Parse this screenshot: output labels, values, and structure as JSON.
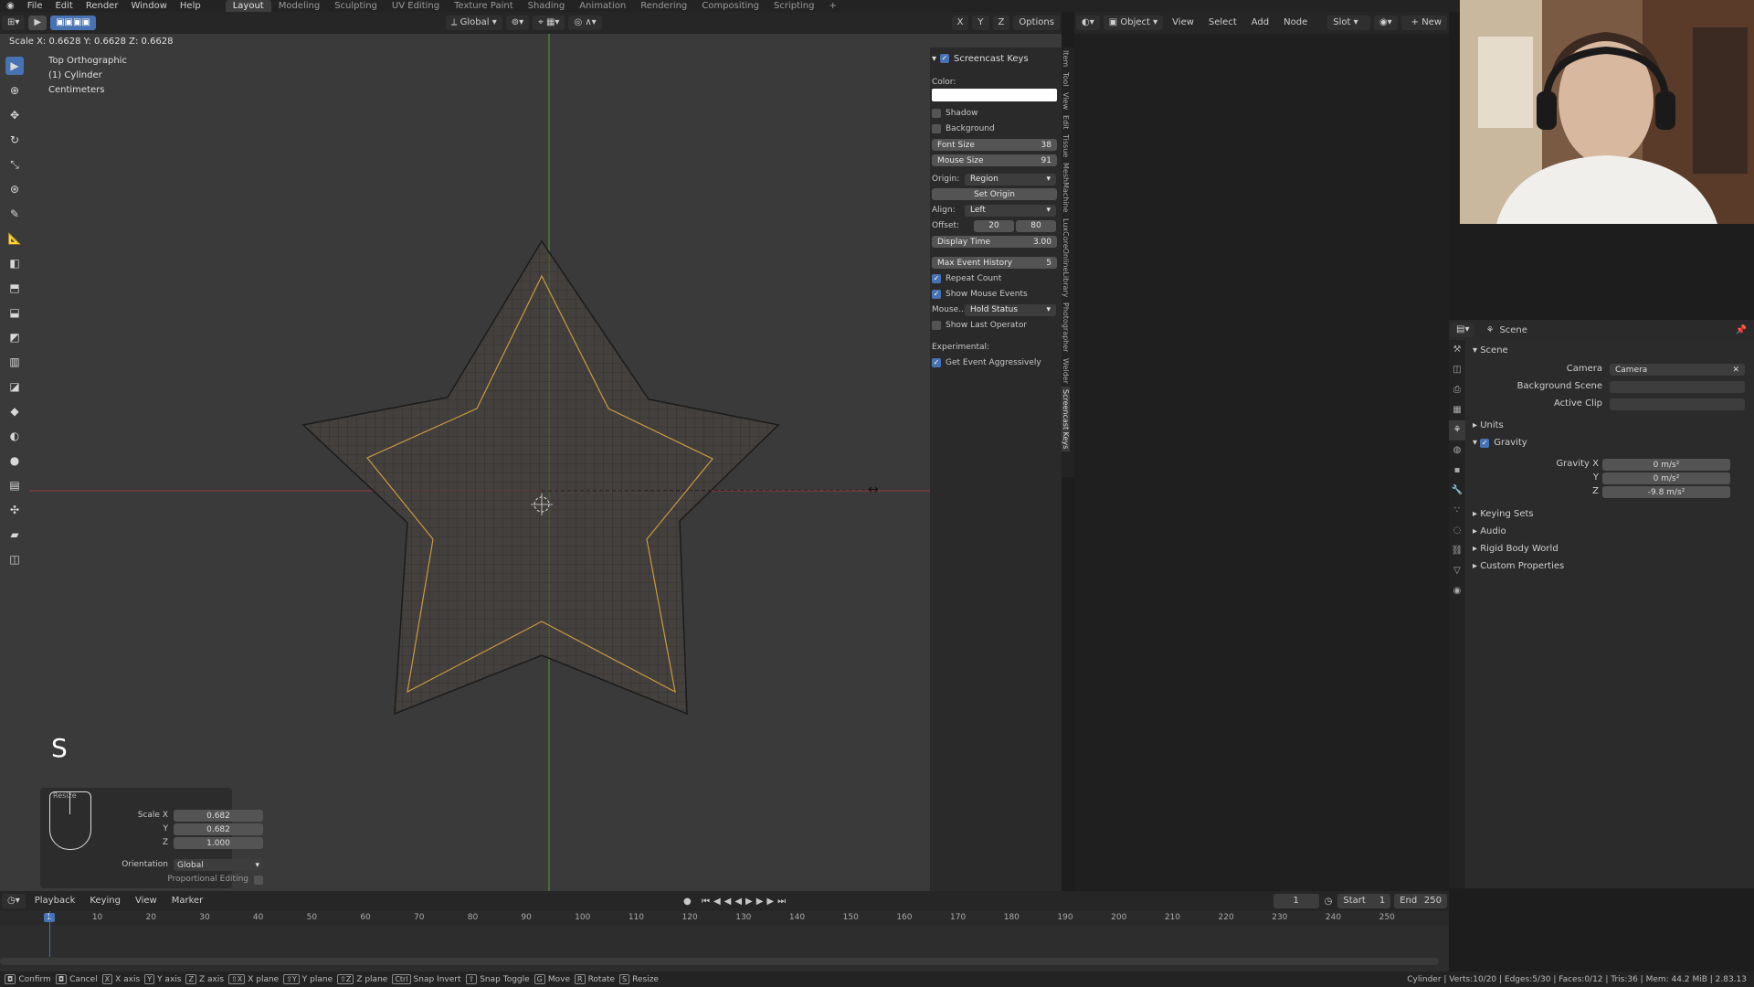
{
  "menu": [
    "File",
    "Edit",
    "Render",
    "Window",
    "Help"
  ],
  "workspaces": [
    "Layout",
    "Modeling",
    "Sculpting",
    "UV Editing",
    "Texture Paint",
    "Shading",
    "Animation",
    "Rendering",
    "Compositing",
    "Scripting",
    "+"
  ],
  "viewport_header": {
    "transform": "Global",
    "options": "Options",
    "axes": [
      "X",
      "Y",
      "Z"
    ]
  },
  "status_scale": "Scale X: 0.6628   Y: 0.6628   Z: 0.6628",
  "overlay": {
    "view": "Top Orthographic",
    "object": "(1) Cylinder",
    "units": "Centimeters"
  },
  "key_overlay": "S",
  "screencast": {
    "title": "Screencast Keys",
    "color_label": "Color:",
    "shadow": "Shadow",
    "background": "Background",
    "font_size_label": "Font Size",
    "font_size": "38",
    "mouse_size_label": "Mouse Size",
    "mouse_size": "91",
    "origin_label": "Origin:",
    "origin": "Region",
    "set_origin": "Set Origin",
    "align_label": "Align:",
    "align": "Left",
    "offset_label": "Offset:",
    "offset_x": "20",
    "offset_y": "80",
    "display_time_label": "Display Time",
    "display_time": "3.00",
    "max_event_label": "Max Event History",
    "max_event": "5",
    "repeat_count": "Repeat Count",
    "show_mouse_events": "Show Mouse Events",
    "mouse_label": "Mouse...",
    "mouse": "Hold Status",
    "show_last_operator": "Show Last Operator",
    "experimental": "Experimental:",
    "get_event": "Get Event Aggressively"
  },
  "npanel_tabs": [
    "Item",
    "Tool",
    "View",
    "Edit",
    "Tissue",
    "MeshMachine",
    "LuxCoreOnlineLibrary",
    "Photographer",
    "Welder",
    "Screencast Keys"
  ],
  "node_header": {
    "object": "Object",
    "view": "View",
    "select": "Select",
    "add": "Add",
    "node": "Node",
    "slot": "Slot",
    "new": "New"
  },
  "props": {
    "context": "Scene",
    "panel": "Scene",
    "camera_label": "Camera",
    "camera": "Camera",
    "bg_scene_label": "Background Scene",
    "active_clip_label": "Active Clip",
    "units": "Units",
    "gravity": "Gravity",
    "gravity_x_label": "Gravity X",
    "gravity_x": "0 m/s²",
    "gravity_y_label": "Y",
    "gravity_y": "0 m/s²",
    "gravity_z_label": "Z",
    "gravity_z": "-9.8 m/s²",
    "keying_sets": "Keying Sets",
    "audio": "Audio",
    "rigid_body": "Rigid Body World",
    "custom_props": "Custom Properties"
  },
  "redo": {
    "title": "Resize",
    "scale_x_label": "Scale X",
    "scale_x": "0.682",
    "y_label": "Y",
    "y": "0.682",
    "z_label": "Z",
    "z": "1.000",
    "orientation_label": "Orientation",
    "orientation": "Global",
    "prop_edit_label": "Proportional Editing"
  },
  "timeline": {
    "menus": [
      "Playback",
      "Keying",
      "View",
      "Marker"
    ],
    "current": "1",
    "start_label": "Start",
    "start": "1",
    "end_label": "End",
    "end": "250",
    "ticks": [
      "1",
      "10",
      "20",
      "30",
      "40",
      "50",
      "60",
      "70",
      "80",
      "90",
      "100",
      "110",
      "120",
      "130",
      "140",
      "150",
      "160",
      "170",
      "180",
      "190",
      "200",
      "210",
      "220",
      "230",
      "240",
      "250"
    ]
  },
  "statusbar": {
    "items": [
      {
        "key": "",
        "label": "Confirm"
      },
      {
        "key": "",
        "label": "Cancel"
      },
      {
        "key": "X",
        "label": "X axis"
      },
      {
        "key": "Y",
        "label": "Y axis"
      },
      {
        "key": "Z",
        "label": "Z axis"
      },
      {
        "key": "⇧X",
        "label": "X plane"
      },
      {
        "key": "⇧Y",
        "label": "Y plane"
      },
      {
        "key": "⇧Z",
        "label": "Z plane"
      },
      {
        "key": "Ctrl",
        "label": "Snap Invert"
      },
      {
        "key": "⇧",
        "label": "Snap Toggle"
      },
      {
        "key": "G",
        "label": "Move"
      },
      {
        "key": "R",
        "label": "Rotate"
      },
      {
        "key": "S",
        "label": "Resize"
      }
    ],
    "right": "Cylinder | Verts:10/20 | Edges:5/30 | Faces:0/12 | Tris:36 | Mem: 44.2 MiB | 2.83.13"
  },
  "colors": {
    "accent": "#4772b3",
    "star_edge": "#d9a441",
    "x_axis": "#9b3a45",
    "y_axis": "#5a9a2d"
  }
}
